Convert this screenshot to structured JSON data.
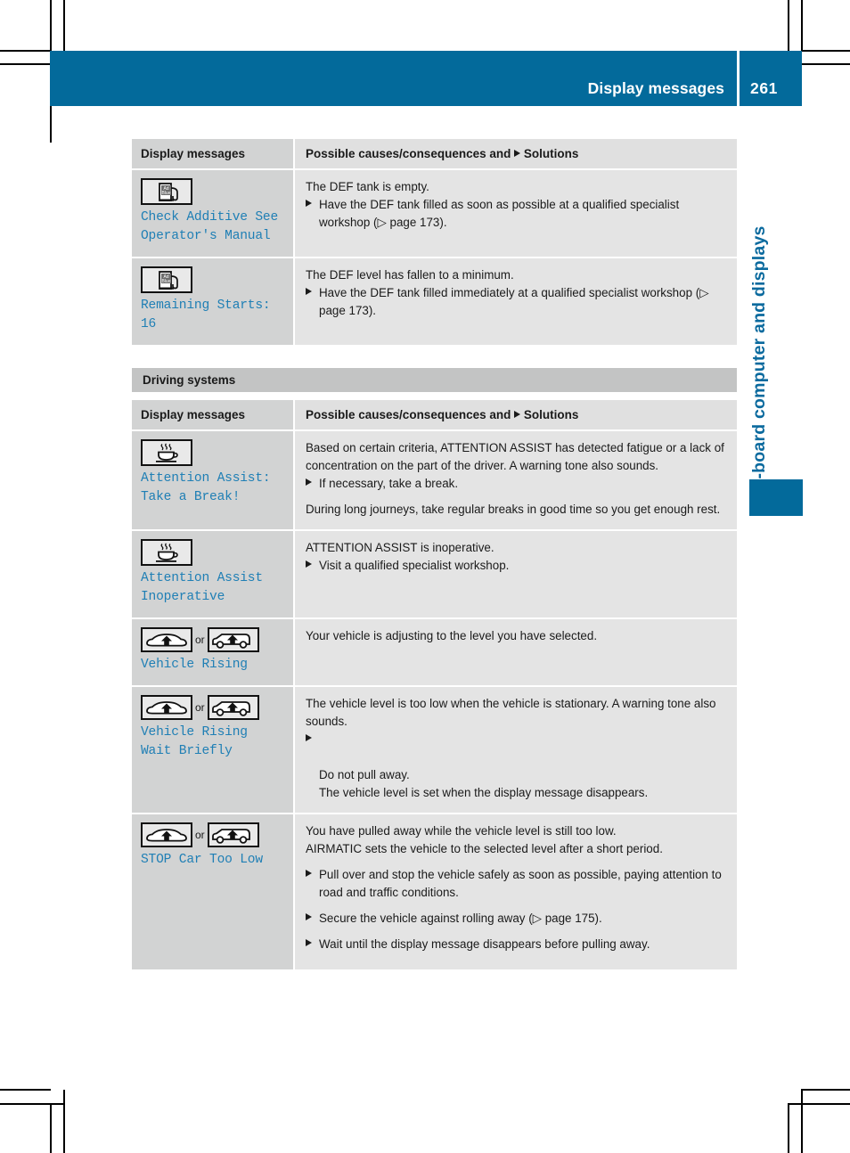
{
  "header": {
    "title": "Display messages",
    "page_number": "261",
    "accent_color": "#036a9b"
  },
  "chapter_tab": {
    "label": "On-board computer and displays",
    "color": "#0b6a9e"
  },
  "table_one": {
    "columns": {
      "left": "Display messages",
      "right_before": "Possible causes/consequences and",
      "right_after": "Solutions"
    },
    "rows": [
      {
        "icon": "adblue-pump-icon",
        "message": "Check Additive See\nOperator's Manual",
        "cause": "The DEF tank is empty.",
        "solutions": [
          "Have the DEF tank filled as soon as possible at a qualified specialist workshop (▷ page 173)."
        ]
      },
      {
        "icon": "adblue-pump-icon",
        "message": "Remaining Starts:\n16",
        "cause": "The DEF level has fallen to a minimum.",
        "solutions": [
          "Have the DEF tank filled immediately at a qualified specialist workshop (▷ page 173)."
        ]
      }
    ]
  },
  "section_two": {
    "heading": "Driving systems",
    "columns": {
      "left": "Display messages",
      "right_before": "Possible causes/consequences and",
      "right_after": "Solutions"
    },
    "rows": [
      {
        "icons": [
          "coffee-cup-icon"
        ],
        "message": "Attention Assist:\nTake a Break!",
        "cause": "Based on certain criteria, ATTENTION ASSIST has detected fatigue or a lack of concentration on the part of the driver. A warning tone also sounds.",
        "solutions": [
          "If necessary, take a break."
        ],
        "note": "During long journeys, take regular breaks in good time so you get enough rest."
      },
      {
        "icons": [
          "coffee-cup-icon"
        ],
        "message": "Attention Assist\nInoperative",
        "cause": "ATTENTION ASSIST is inoperative.",
        "solutions": [
          "Visit a qualified specialist workshop."
        ],
        "note": ""
      },
      {
        "icons": [
          "sedan-rising-icon",
          "estate-rising-icon"
        ],
        "icon_separator": "or",
        "message": "Vehicle Rising",
        "cause": "Your vehicle is adjusting to the level you have selected.",
        "solutions": [],
        "note": ""
      },
      {
        "icons": [
          "sedan-rising-icon",
          "estate-rising-icon"
        ],
        "icon_separator": "or",
        "message": "Vehicle Rising\nWait Briefly",
        "cause": "The vehicle level is too low when the vehicle is stationary. A warning tone also sounds.",
        "solutions": [
          "Do not pull away.\nThe vehicle level is set when the display message disappears."
        ],
        "note": ""
      },
      {
        "icons": [
          "sedan-rising-icon",
          "estate-rising-icon"
        ],
        "icon_separator": "or",
        "message": "STOP Car Too Low",
        "cause": "You have pulled away while the vehicle level is still too low.",
        "cause2": "AIRMATIC sets the vehicle to the selected level after a short period.",
        "solutions": [
          "Pull over and stop the vehicle safely as soon as possible, paying attention to road and traffic conditions.",
          "Secure the vehicle against rolling away (▷ page 175).",
          "Wait until the display message disappears before pulling away."
        ],
        "note": ""
      }
    ]
  }
}
